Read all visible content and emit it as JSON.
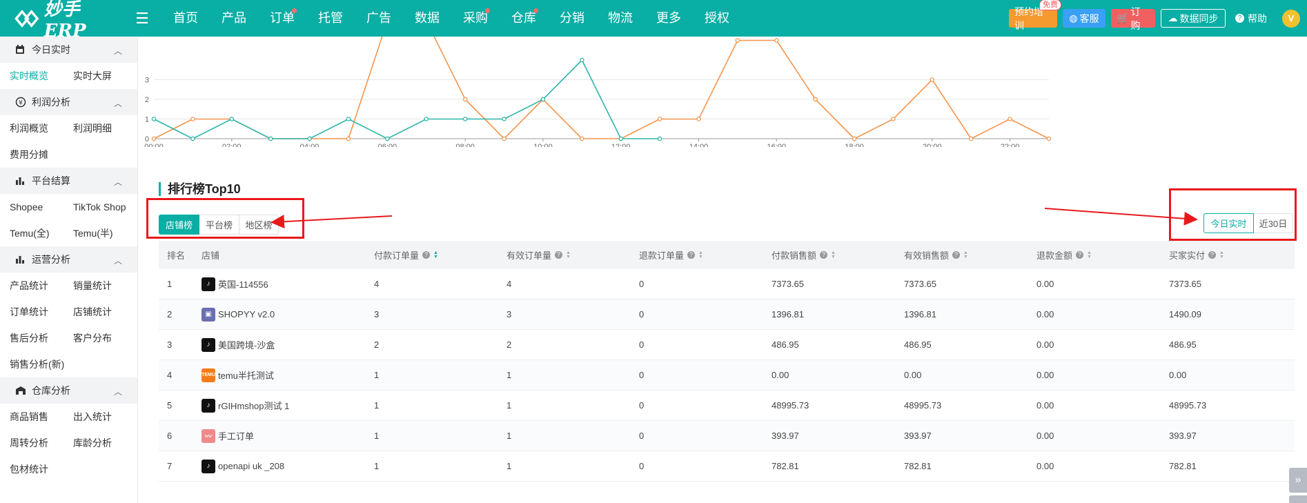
{
  "header": {
    "logo_text": "妙手ERP",
    "nav": [
      {
        "label": "首页",
        "dot": false
      },
      {
        "label": "产品",
        "dot": false
      },
      {
        "label": "订单",
        "dot": true
      },
      {
        "label": "托管",
        "dot": false
      },
      {
        "label": "广告",
        "dot": false
      },
      {
        "label": "数据",
        "dot": false
      },
      {
        "label": "采购",
        "dot": true
      },
      {
        "label": "仓库",
        "dot": true
      },
      {
        "label": "分销",
        "dot": false
      },
      {
        "label": "物流",
        "dot": false
      },
      {
        "label": "更多",
        "dot": false
      },
      {
        "label": "授权",
        "dot": false
      }
    ],
    "train_label": "预约培训",
    "free_badge": "免费",
    "service_label": "客服",
    "order_label": "订购",
    "sync_label": "数据同步",
    "help_label": "帮助",
    "avatar_letter": "V"
  },
  "sidebar": {
    "groups": [
      {
        "title": "今日实时",
        "icon": "calendar-icon",
        "items": [
          {
            "label": "实时概览",
            "active": true
          },
          {
            "label": "实时大屏",
            "active": false
          }
        ]
      },
      {
        "title": "利润分析",
        "icon": "profit-icon",
        "items": [
          {
            "label": "利润概览",
            "active": false
          },
          {
            "label": "利润明细",
            "active": false
          },
          {
            "label": "费用分摊",
            "active": false
          }
        ]
      },
      {
        "title": "平台结算",
        "icon": "bar-chart-icon",
        "items": [
          {
            "label": "Shopee",
            "active": false
          },
          {
            "label": "TikTok Shop",
            "active": false
          },
          {
            "label": "Temu(全)",
            "active": false
          },
          {
            "label": "Temu(半)",
            "active": false
          }
        ]
      },
      {
        "title": "运营分析",
        "icon": "bar-chart-icon",
        "items": [
          {
            "label": "产品统计",
            "active": false
          },
          {
            "label": "销量统计",
            "active": false
          },
          {
            "label": "订单统计",
            "active": false
          },
          {
            "label": "店铺统计",
            "active": false
          },
          {
            "label": "售后分析",
            "active": false
          },
          {
            "label": "客户分布",
            "active": false
          },
          {
            "label": "销售分析(新)",
            "active": false
          }
        ]
      },
      {
        "title": "仓库分析",
        "icon": "warehouse-icon",
        "items": [
          {
            "label": "商品销售",
            "active": false
          },
          {
            "label": "出入统计",
            "active": false
          },
          {
            "label": "周转分析",
            "active": false
          },
          {
            "label": "库龄分析",
            "active": false
          },
          {
            "label": "包材统计",
            "active": false
          }
        ]
      }
    ]
  },
  "chart_data": {
    "type": "line",
    "x": [
      "00:00",
      "01:00",
      "02:00",
      "03:00",
      "04:00",
      "05:00",
      "06:00",
      "07:00",
      "08:00",
      "09:00",
      "10:00",
      "11:00",
      "12:00",
      "13:00",
      "14:00",
      "15:00",
      "16:00",
      "17:00",
      "18:00",
      "19:00",
      "20:00",
      "21:00",
      "22:00",
      "23:00"
    ],
    "x_tick_labels": [
      "00:00",
      "02:00",
      "04:00",
      "06:00",
      "08:00",
      "10:00",
      "12:00",
      "14:00",
      "16:00",
      "18:00",
      "20:00",
      "22:00"
    ],
    "y_tick_labels": [
      "0",
      "1",
      "2",
      "3"
    ],
    "series": [
      {
        "color": "#2bb5a8",
        "values": [
          1,
          0,
          1,
          0,
          0,
          1,
          0,
          1,
          1,
          1,
          2,
          4,
          0,
          0,
          null,
          null,
          null,
          null,
          null,
          null,
          null,
          null,
          null,
          null
        ]
      },
      {
        "color": "#f5944a",
        "values": [
          0,
          1,
          1,
          0,
          0,
          0,
          6,
          6,
          2,
          0,
          2,
          0,
          0,
          1,
          1,
          5,
          5,
          2,
          0,
          1,
          3,
          0,
          1,
          0
        ]
      }
    ],
    "grid": true
  },
  "ranking": {
    "title": "排行榜Top10",
    "tabs": [
      {
        "label": "店铺榜",
        "active": true
      },
      {
        "label": "平台榜",
        "active": false
      },
      {
        "label": "地区榜",
        "active": false
      }
    ],
    "range_tabs": [
      {
        "label": "今日实时",
        "active": true
      },
      {
        "label": "近30日",
        "active": false
      }
    ],
    "columns": [
      "排名",
      "店铺",
      "付款订单量",
      "有效订单量",
      "退款订单量",
      "付款销售额",
      "有效销售额",
      "退款金额",
      "买家实付"
    ],
    "rows": [
      {
        "rank": "1",
        "shop": "英国-114556",
        "icon": "tiktok-icon",
        "paid_orders": "4",
        "valid_orders": "4",
        "refund_orders": "0",
        "paid_sales": "7373.65",
        "valid_sales": "7373.65",
        "refund_amount": "0.00",
        "buyer_paid": "7373.65"
      },
      {
        "rank": "2",
        "shop": "SHOPYY v2.0",
        "icon": "shopyy-icon",
        "paid_orders": "3",
        "valid_orders": "3",
        "refund_orders": "0",
        "paid_sales": "1396.81",
        "valid_sales": "1396.81",
        "refund_amount": "0.00",
        "buyer_paid": "1490.09"
      },
      {
        "rank": "3",
        "shop": "美国跨境-沙盒",
        "icon": "tiktok-icon",
        "paid_orders": "2",
        "valid_orders": "2",
        "refund_orders": "0",
        "paid_sales": "486.95",
        "valid_sales": "486.95",
        "refund_amount": "0.00",
        "buyer_paid": "486.95"
      },
      {
        "rank": "4",
        "shop": "temu半托测试",
        "icon": "temu-icon",
        "paid_orders": "1",
        "valid_orders": "1",
        "refund_orders": "0",
        "paid_sales": "0.00",
        "valid_sales": "0.00",
        "refund_amount": "0.00",
        "buyer_paid": "0.00"
      },
      {
        "rank": "5",
        "shop": "rGIHmshop测试 1",
        "icon": "tiktok-icon",
        "paid_orders": "1",
        "valid_orders": "1",
        "refund_orders": "0",
        "paid_sales": "48995.73",
        "valid_sales": "48995.73",
        "refund_amount": "0.00",
        "buyer_paid": "48995.73"
      },
      {
        "rank": "6",
        "shop": "手工订单",
        "icon": "manual-order-icon",
        "paid_orders": "1",
        "valid_orders": "1",
        "refund_orders": "0",
        "paid_sales": "393.97",
        "valid_sales": "393.97",
        "refund_amount": "0.00",
        "buyer_paid": "393.97"
      },
      {
        "rank": "7",
        "shop": "openapi uk _208",
        "icon": "tiktok-icon",
        "paid_orders": "1",
        "valid_orders": "1",
        "refund_orders": "0",
        "paid_sales": "782.81",
        "valid_sales": "782.81",
        "refund_amount": "0.00",
        "buyer_paid": "782.81"
      }
    ]
  }
}
